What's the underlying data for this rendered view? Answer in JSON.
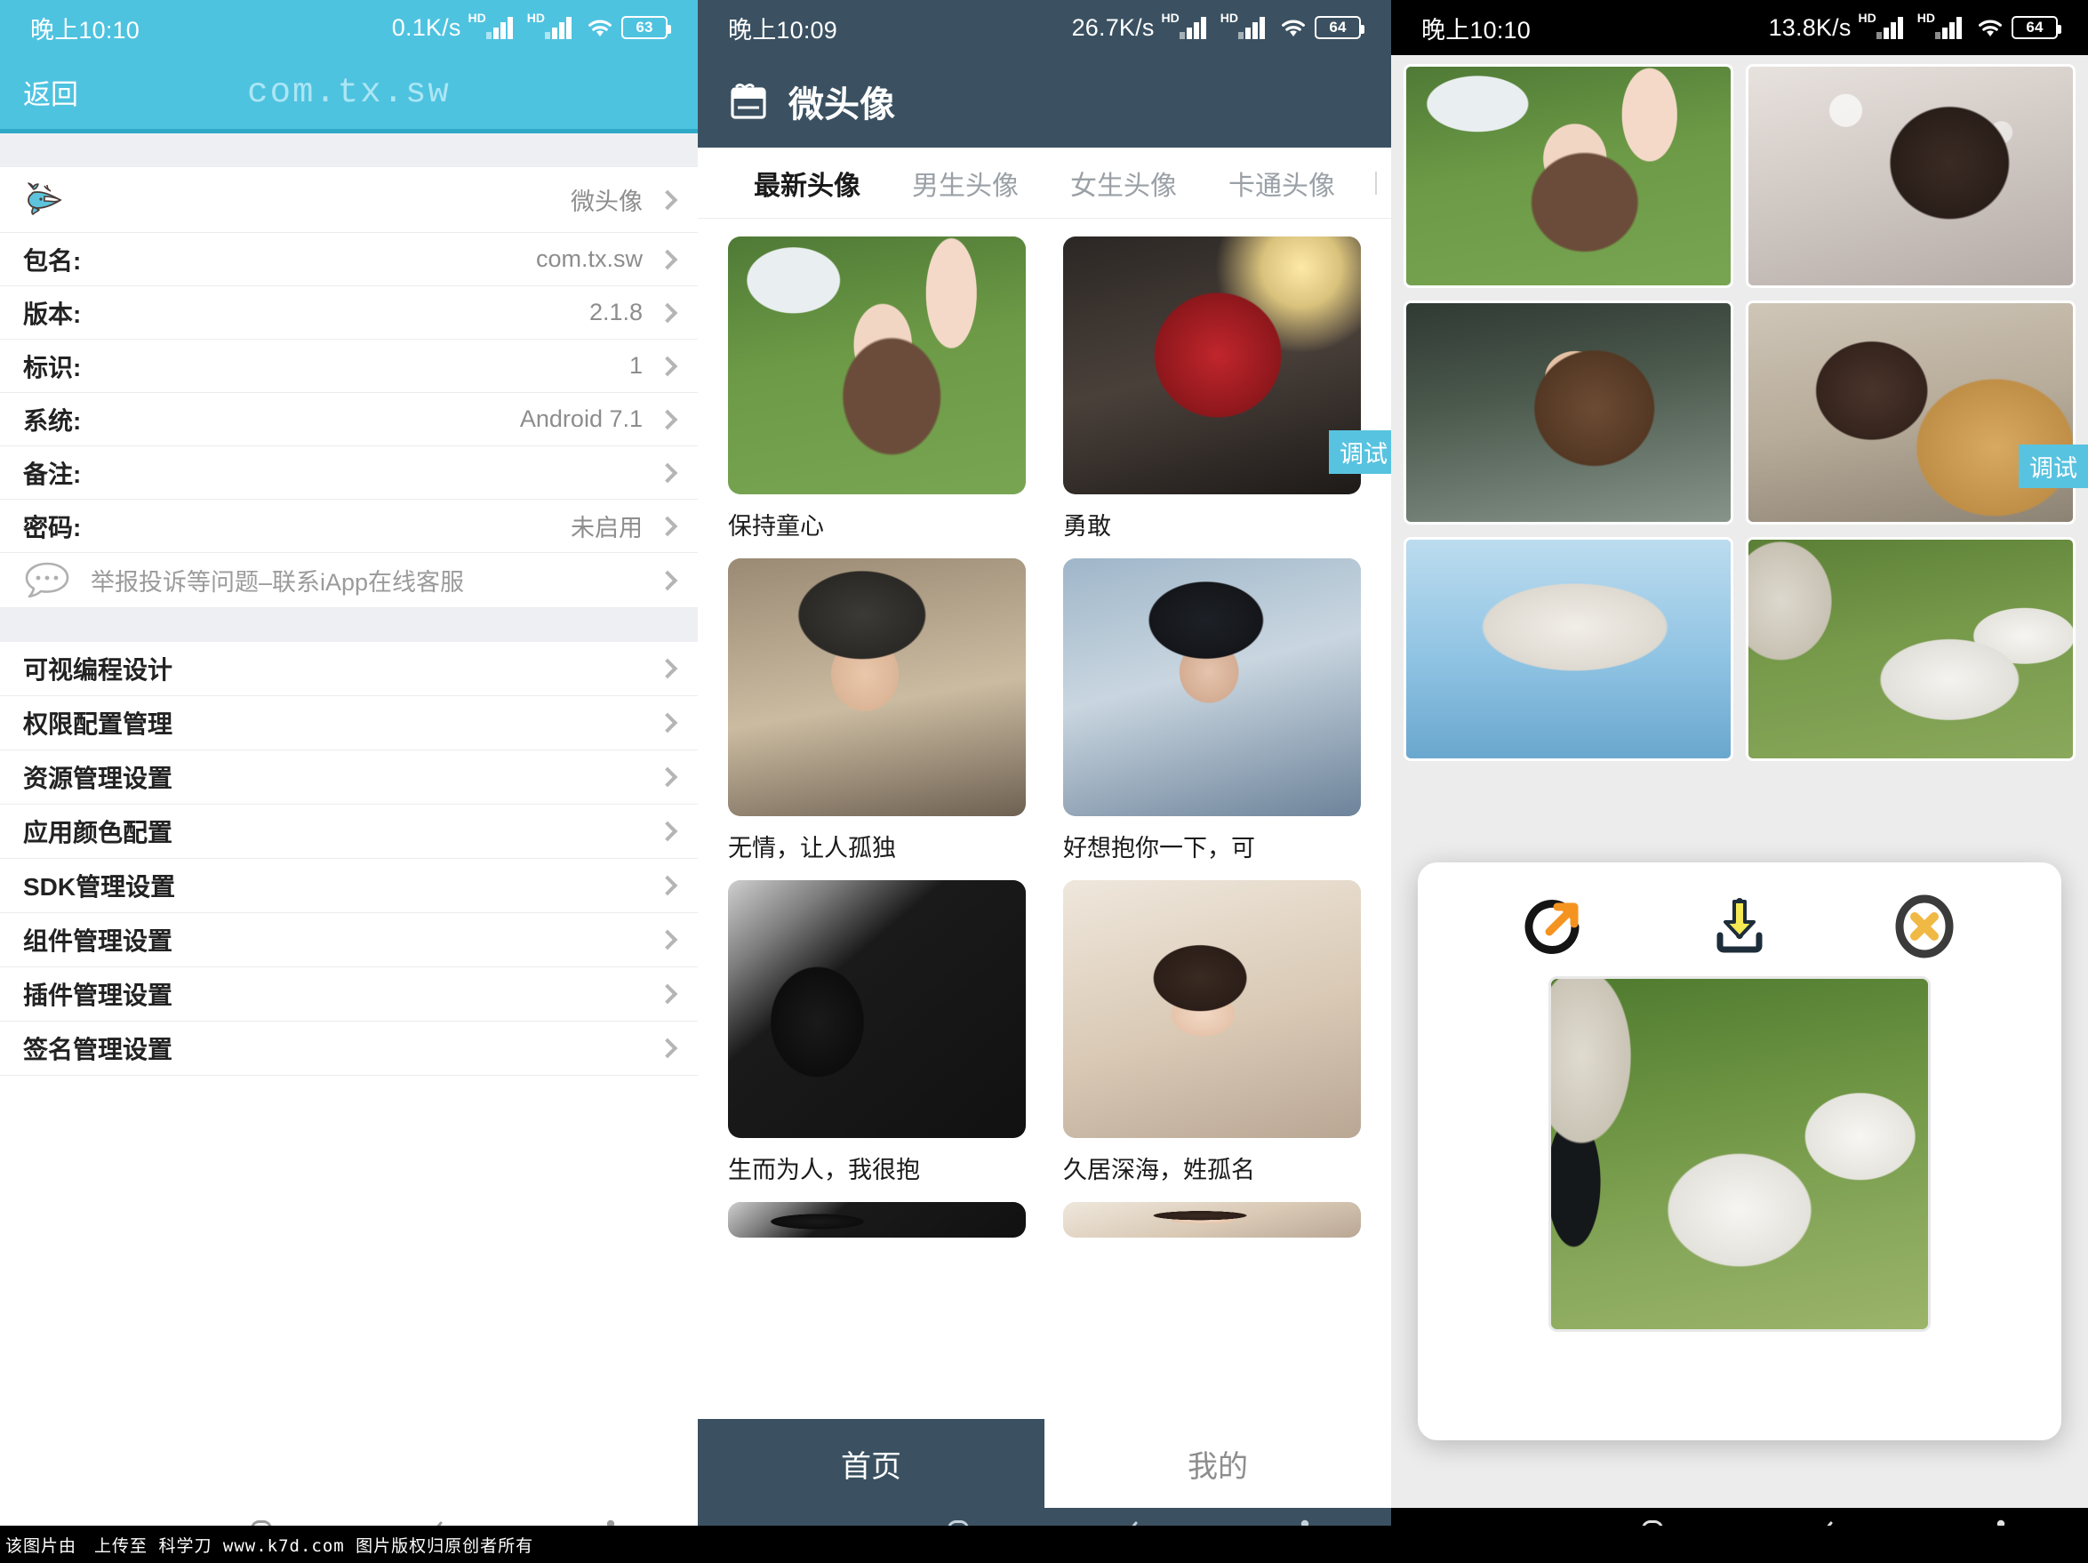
{
  "panel_left": {
    "statusbar": {
      "time": "晚上10:10",
      "speed": "0.1K/s",
      "hd1": "HD",
      "hd2": "HD",
      "battery": "63"
    },
    "header": {
      "back_label": "返回",
      "package_title": "com.tx.sw"
    },
    "app_row": {
      "icon": "whale-icon",
      "name": "微头像"
    },
    "info_rows": [
      {
        "label": "包名:",
        "value": "com.tx.sw"
      },
      {
        "label": "版本:",
        "value": "2.1.8"
      },
      {
        "label": "标识:",
        "value": "1"
      },
      {
        "label": "系统:",
        "value": "Android 7.1"
      },
      {
        "label": "备注:",
        "value": ""
      },
      {
        "label": "密码:",
        "value": "未启用"
      }
    ],
    "support_row": {
      "icon": "chat-bubble-icon",
      "text": "举报投诉等问题–联系iApp在线客服"
    },
    "menu_rows": [
      {
        "label": "可视编程设计"
      },
      {
        "label": "权限配置管理"
      },
      {
        "label": "资源管理设置"
      },
      {
        "label": "应用颜色配置"
      },
      {
        "label": "SDK管理设置"
      },
      {
        "label": "组件管理设置"
      },
      {
        "label": "插件管理设置"
      },
      {
        "label": "签名管理设置"
      }
    ],
    "colors": {
      "header_bg": "#4ec3e0",
      "header_underline": "#2fa9c8",
      "package_text": "#ace6f4"
    }
  },
  "panel_middle": {
    "statusbar": {
      "time": "晚上10:09",
      "speed": "26.7K/s",
      "hd1": "HD",
      "hd2": "HD",
      "battery": "64"
    },
    "header": {
      "icon": "gift-bag-icon",
      "title": "微头像"
    },
    "tabs": [
      {
        "label": "最新头像",
        "active": true
      },
      {
        "label": "男生头像",
        "active": false
      },
      {
        "label": "女生头像",
        "active": false
      },
      {
        "label": "卡通头像",
        "active": false
      }
    ],
    "avatars": [
      {
        "caption": "保持童心",
        "photo": "ph-grassgirl"
      },
      {
        "caption": "勇敢",
        "photo": "ph-spider",
        "badge": "调试"
      },
      {
        "caption": "无情，让人孤独",
        "photo": "ph-capguy"
      },
      {
        "caption": "好想抱你一下，可",
        "photo": "ph-blueboy"
      },
      {
        "caption": "生而为人，我很抱",
        "photo": "ph-shadow"
      },
      {
        "caption": "久居深海，姓孤名",
        "photo": "ph-sleep"
      }
    ],
    "bottom_tabs": [
      {
        "label": "首页",
        "selected": true
      },
      {
        "label": "我的",
        "selected": false
      }
    ],
    "colors": {
      "header_bg": "#3b5161",
      "badge_bg": "#58c3e0"
    }
  },
  "panel_right": {
    "statusbar": {
      "time": "晚上10:10",
      "speed": "13.8K/s",
      "hd1": "HD",
      "hd2": "HD",
      "battery": "64"
    },
    "gallery": [
      {
        "photo": "ph-grassgirl"
      },
      {
        "photo": "ph-bubble"
      },
      {
        "photo": "ph-coffee"
      },
      {
        "photo": "ph-sweater",
        "badge": "调试"
      },
      {
        "photo": "ph-hat"
      },
      {
        "photo": "ph-goat"
      }
    ],
    "dialog": {
      "actions": [
        {
          "name": "share-icon",
          "label": "share"
        },
        {
          "name": "download-icon",
          "label": "download"
        },
        {
          "name": "close-icon",
          "label": "close"
        }
      ],
      "preview_photo": "ph-goat-big"
    },
    "colors": {
      "badge_bg": "#58c3e0",
      "share_accent": "#f59321",
      "download_accent": "#f2e24a",
      "close_accent": "#f0b944"
    }
  },
  "navbar": {
    "icons": [
      "menu-icon",
      "home-icon",
      "back-icon",
      "accessibility-icon"
    ]
  },
  "watermark": {
    "text": "该图片由　上传至 科学刀 www.k7d.com 图片版权归原创者所有"
  }
}
